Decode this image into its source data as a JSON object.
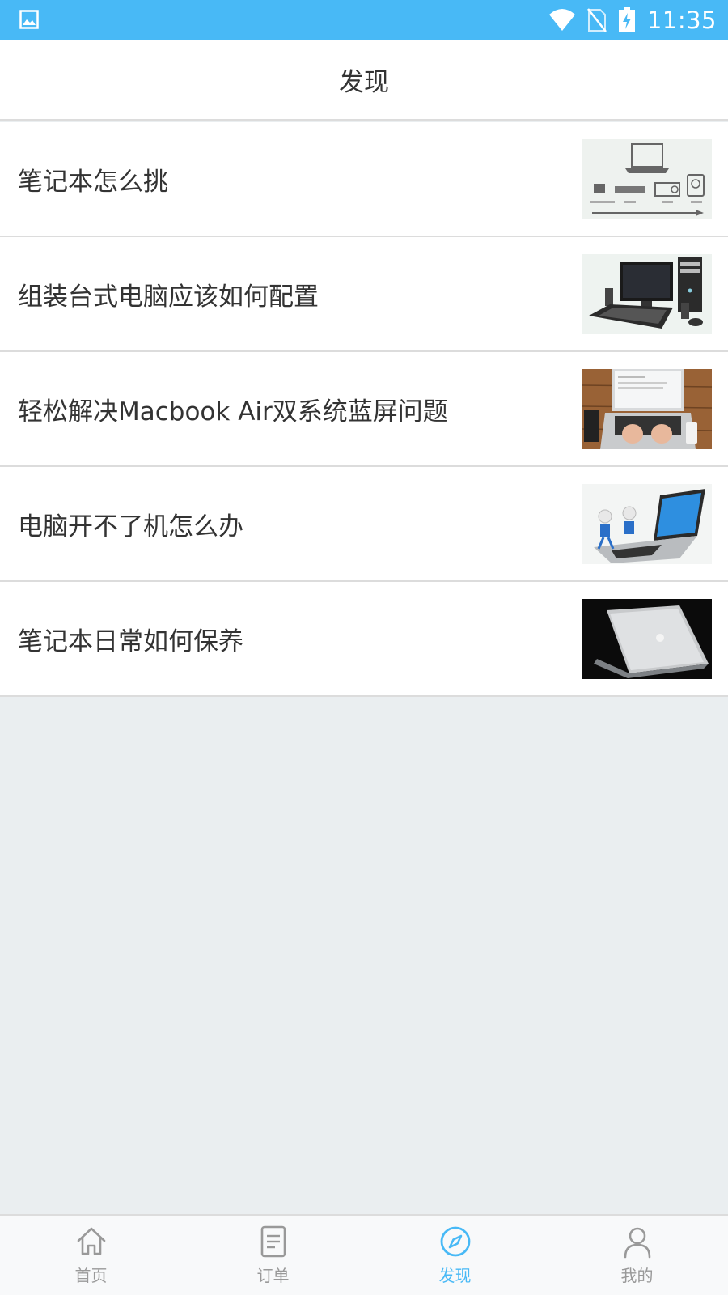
{
  "status_bar": {
    "time": "11:35"
  },
  "app_bar": {
    "title": "发现"
  },
  "articles": [
    {
      "title": "笔记本怎么挑",
      "image": "laptop-components-diagram"
    },
    {
      "title": "组装台式电脑应该如何配置",
      "image": "desktop-computer-photo"
    },
    {
      "title": "轻松解决Macbook Air双系统蓝屏问题",
      "image": "hands-typing-laptop-photo"
    },
    {
      "title": "电脑开不了机怎么办",
      "image": "figures-on-laptop-illustration"
    },
    {
      "title": "笔记本日常如何保养",
      "image": "silver-macbook-photo"
    }
  ],
  "bottom_nav": {
    "items": [
      {
        "label": "首页",
        "icon": "home-icon"
      },
      {
        "label": "订单",
        "icon": "document-icon"
      },
      {
        "label": "发现",
        "icon": "compass-icon",
        "active": true
      },
      {
        "label": "我的",
        "icon": "person-icon"
      }
    ]
  },
  "colors": {
    "accent": "#48b9f6",
    "inactive": "#999999",
    "background": "#eaeef0"
  }
}
